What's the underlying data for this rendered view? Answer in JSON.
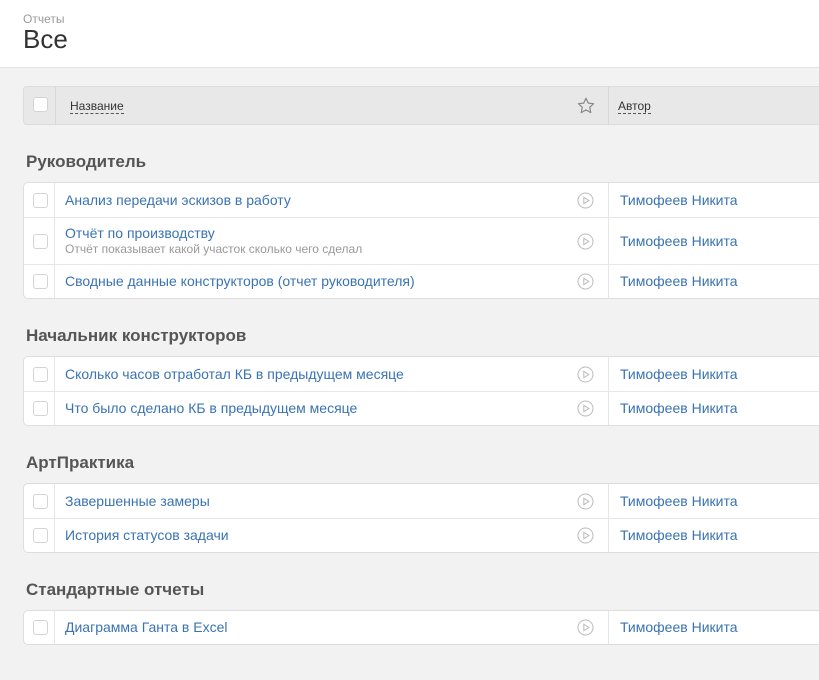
{
  "header": {
    "breadcrumb": "Отчеты",
    "title": "Все"
  },
  "table": {
    "col_name": "Название",
    "col_author": "Автор"
  },
  "groups": [
    {
      "title": "Руководитель",
      "rows": [
        {
          "title": "Анализ передачи эскизов в работу",
          "subtitle": "",
          "author": "Тимофеев Никита"
        },
        {
          "title": "Отчёт по производству",
          "subtitle": "Отчёт показывает какой участок сколько чего сделал",
          "author": "Тимофеев Никита"
        },
        {
          "title": "Сводные данные конструкторов (отчет руководителя)",
          "subtitle": "",
          "author": "Тимофеев Никита"
        }
      ]
    },
    {
      "title": "Начальник конструкторов",
      "rows": [
        {
          "title": "Сколько часов отработал КБ в предыдущем месяце",
          "subtitle": "",
          "author": "Тимофеев Никита"
        },
        {
          "title": "Что было сделано КБ в предыдущем месяце",
          "subtitle": "",
          "author": "Тимофеев Никита"
        }
      ]
    },
    {
      "title": "АртПрактика",
      "rows": [
        {
          "title": "Завершенные замеры",
          "subtitle": "",
          "author": "Тимофеев Никита"
        },
        {
          "title": "История статусов задачи",
          "subtitle": "",
          "author": "Тимофеев Никита"
        }
      ]
    },
    {
      "title": "Стандартные отчеты",
      "rows": [
        {
          "title": "Диаграмма Ганта в Excel",
          "subtitle": "",
          "author": "Тимофеев Никита"
        }
      ]
    }
  ]
}
